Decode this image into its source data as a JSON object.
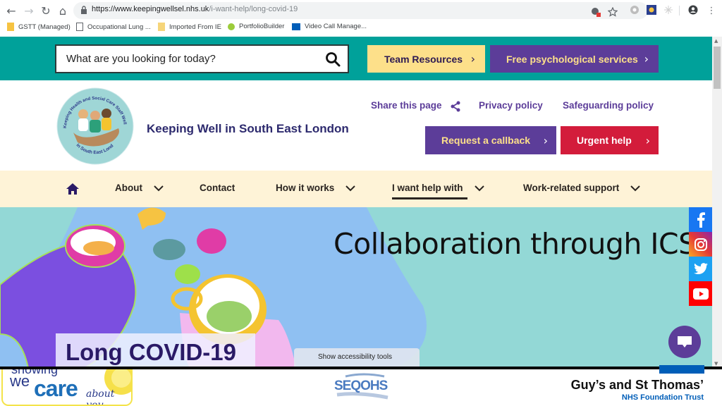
{
  "browser": {
    "url_host": "https://www.keepingwellsel.nhs.uk",
    "url_path": "/i-want-help/long-covid-19",
    "bookmarks": [
      {
        "label": "GSTT (Managed)",
        "icon": "folder-icon"
      },
      {
        "label": "Occupational Lung ...",
        "icon": "page-icon"
      },
      {
        "label": "Imported From IE",
        "icon": "folder-icon"
      },
      {
        "label": "PortfolioBuilder",
        "icon": "portfolio-icon"
      },
      {
        "label": "Video Call Manage...",
        "icon": "nhs-icon"
      }
    ]
  },
  "site": {
    "search": {
      "placeholder": "What are you looking for today?"
    },
    "top_buttons": {
      "team_resources": "Team Resources",
      "free_psych": "Free psychological services"
    },
    "title": "Keeping Well in South East London",
    "logo_text": "Keeping Health and Social Care Staff Well in South East London",
    "header_links": {
      "share": "Share this page",
      "privacy": "Privacy policy",
      "safeguarding": "Safeguarding policy"
    },
    "header_buttons": {
      "callback": "Request a callback",
      "urgent": "Urgent help"
    },
    "nav": [
      {
        "label": "About",
        "dropdown": true
      },
      {
        "label": "Contact",
        "dropdown": false
      },
      {
        "label": "How it works",
        "dropdown": true
      },
      {
        "label": "I want help with",
        "dropdown": true,
        "active": true
      },
      {
        "label": "Work-related support",
        "dropdown": true
      }
    ],
    "hero": {
      "heading_overlay": "Collaboration through ICS",
      "page_label": "Long COVID-19",
      "accessibility_button": "Show accessibility tools"
    },
    "social": [
      "facebook-icon",
      "instagram-icon",
      "twitter-icon",
      "youtube-icon"
    ]
  },
  "footer": {
    "swc": {
      "line1": "showing",
      "line2": "we",
      "line3": "care",
      "line4": "about you"
    },
    "seqohs": "SEQOHS",
    "gst_name": "Guy’s and St Thomas’",
    "gst_sub": "NHS Foundation Trust"
  },
  "colors": {
    "teal": "#00a19a",
    "purple": "#5c3d99",
    "yellow": "#fde08a",
    "red": "#d31c3b",
    "cream": "#fef3d7"
  }
}
